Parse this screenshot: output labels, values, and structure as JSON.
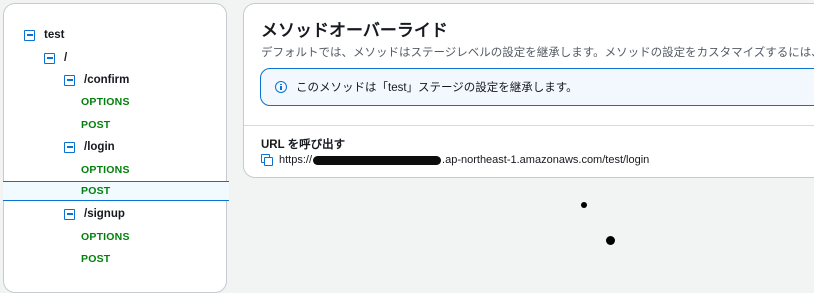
{
  "tree": {
    "items": [
      {
        "label": "test",
        "kind": "path",
        "expanded": true
      },
      {
        "label": "/",
        "kind": "path",
        "expanded": true
      },
      {
        "label": "/confirm",
        "kind": "path",
        "expanded": true
      },
      {
        "label": "OPTIONS",
        "kind": "method"
      },
      {
        "label": "POST",
        "kind": "method"
      },
      {
        "label": "/login",
        "kind": "path",
        "expanded": true
      },
      {
        "label": "OPTIONS",
        "kind": "method"
      },
      {
        "label": "POST",
        "kind": "method",
        "selected": true
      },
      {
        "label": "/signup",
        "kind": "path",
        "expanded": true
      },
      {
        "label": "OPTIONS",
        "kind": "method"
      },
      {
        "label": "POST",
        "kind": "method"
      }
    ]
  },
  "override": {
    "title": "メソッドオーバーライド",
    "description": "デフォルトでは、メソッドはステージレベルの設定を継承します。メソッドの設定をカスタマイズするには、メ",
    "info_text": "このメソッドは「test」ステージの設定を継承します。"
  },
  "invoke_url": {
    "label": "URL を呼び出す",
    "prefix": "https://",
    "suffix": ".ap-northeast-1.amazonaws.com/test/login"
  },
  "colors": {
    "accent": "#0972d3",
    "method_green": "#037f0c",
    "selected_bg": "#f1faff"
  },
  "icons": {
    "toggle": "minus-square-icon",
    "info": "info-circle-icon",
    "copy": "copy-icon"
  }
}
